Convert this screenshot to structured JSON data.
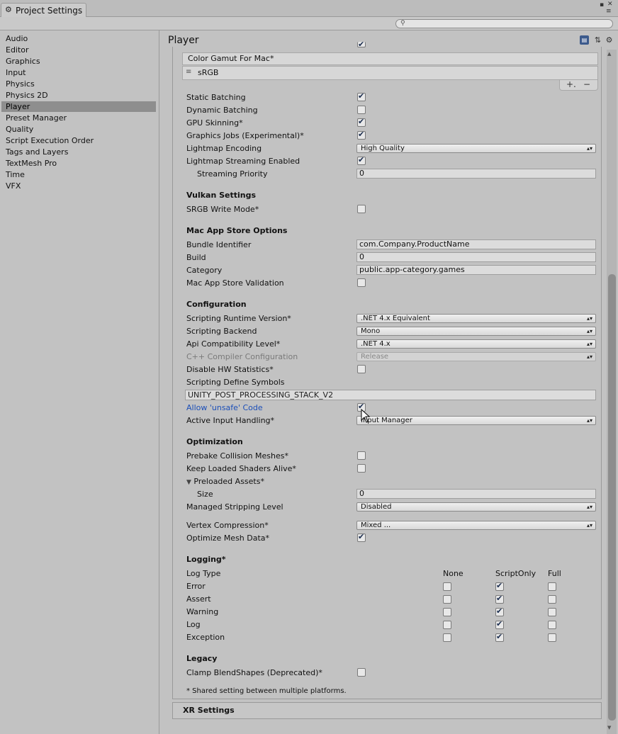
{
  "window": {
    "tab_title": "Project Settings",
    "tab_icon": "gear-icon"
  },
  "search": {
    "placeholder": ""
  },
  "sidebar": {
    "items": [
      {
        "label": "Audio"
      },
      {
        "label": "Editor"
      },
      {
        "label": "Graphics"
      },
      {
        "label": "Input"
      },
      {
        "label": "Physics"
      },
      {
        "label": "Physics 2D"
      },
      {
        "label": "Player",
        "active": true
      },
      {
        "label": "Preset Manager"
      },
      {
        "label": "Quality"
      },
      {
        "label": "Script Execution Order"
      },
      {
        "label": "Tags and Layers"
      },
      {
        "label": "TextMesh Pro"
      },
      {
        "label": "Time"
      },
      {
        "label": "VFX"
      }
    ]
  },
  "main": {
    "title": "Player",
    "header_icons": [
      "book-icon",
      "sliders-icon",
      "gear-icon"
    ]
  },
  "gamut": {
    "header": "Color Gamut For Mac*",
    "item": "sRGB",
    "add": "+.",
    "remove": "−"
  },
  "rendering": {
    "static_batching": {
      "label": "Static Batching",
      "checked": true
    },
    "dynamic_batching": {
      "label": "Dynamic Batching",
      "checked": false
    },
    "gpu_skinning": {
      "label": "GPU Skinning*",
      "checked": true
    },
    "graphics_jobs": {
      "label": "Graphics Jobs (Experimental)*",
      "checked": true
    },
    "lightmap_encoding": {
      "label": "Lightmap Encoding",
      "value": "High Quality"
    },
    "lightmap_streaming": {
      "label": "Lightmap Streaming Enabled",
      "checked": true
    },
    "streaming_priority": {
      "label": "Streaming Priority",
      "value": "0"
    }
  },
  "vulkan": {
    "heading": "Vulkan Settings",
    "srgb_write": {
      "label": "SRGB Write Mode*",
      "checked": false
    }
  },
  "mac_store": {
    "heading": "Mac App Store Options",
    "bundle_id": {
      "label": "Bundle Identifier",
      "value": "com.Company.ProductName"
    },
    "build": {
      "label": "Build",
      "value": "0"
    },
    "category": {
      "label": "Category",
      "value": "public.app-category.games"
    },
    "validation": {
      "label": "Mac App Store Validation",
      "checked": false
    }
  },
  "configuration": {
    "heading": "Configuration",
    "runtime": {
      "label": "Scripting Runtime Version*",
      "value": ".NET 4.x Equivalent"
    },
    "backend": {
      "label": "Scripting Backend",
      "value": "Mono"
    },
    "api_level": {
      "label": "Api Compatibility Level*",
      "value": ".NET 4.x"
    },
    "cpp_config": {
      "label": "C++ Compiler Configuration",
      "value": "Release"
    },
    "disable_hw_stats": {
      "label": "Disable HW Statistics*",
      "checked": false
    },
    "define_symbols": {
      "label": "Scripting Define Symbols",
      "value": "UNITY_POST_PROCESSING_STACK_V2"
    },
    "unsafe_code": {
      "label": "Allow 'unsafe' Code",
      "checked": true
    },
    "input_handling": {
      "label": "Active Input Handling*",
      "value": "Input Manager"
    }
  },
  "optimization": {
    "heading": "Optimization",
    "prebake": {
      "label": "Prebake Collision Meshes*",
      "checked": false
    },
    "keep_shaders": {
      "label": "Keep Loaded Shaders Alive*",
      "checked": false
    },
    "preloaded": {
      "label": "Preloaded Assets*"
    },
    "preloaded_size": {
      "label": "Size",
      "value": "0"
    },
    "stripping": {
      "label": "Managed Stripping Level",
      "value": "Disabled"
    },
    "vertex_compression": {
      "label": "Vertex Compression*",
      "value": "Mixed ..."
    },
    "optimize_mesh": {
      "label": "Optimize Mesh Data*",
      "checked": true
    }
  },
  "logging": {
    "heading": "Logging*",
    "type_header": "Log Type",
    "columns": [
      "None",
      "ScriptOnly",
      "Full"
    ],
    "rows": [
      {
        "label": "Error",
        "checked": [
          false,
          true,
          false
        ]
      },
      {
        "label": "Assert",
        "checked": [
          false,
          true,
          false
        ]
      },
      {
        "label": "Warning",
        "checked": [
          false,
          true,
          false
        ]
      },
      {
        "label": "Log",
        "checked": [
          false,
          true,
          false
        ]
      },
      {
        "label": "Exception",
        "checked": [
          false,
          true,
          false
        ]
      }
    ]
  },
  "legacy": {
    "heading": "Legacy",
    "clamp_blendshapes": {
      "label": "Clamp BlendShapes (Deprecated)*",
      "checked": false
    }
  },
  "footnote": "* Shared setting between multiple platforms.",
  "xr": {
    "heading": "XR Settings"
  }
}
